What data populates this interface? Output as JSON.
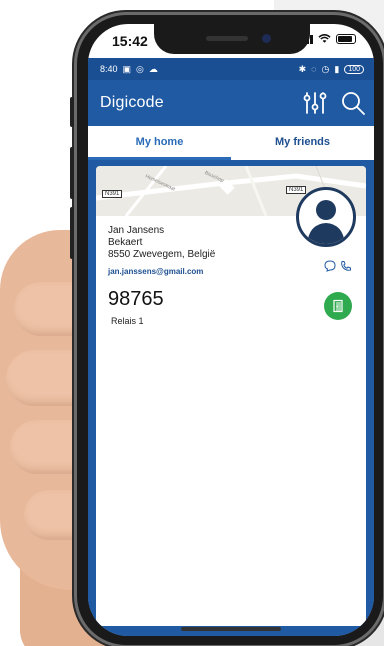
{
  "ios_status": {
    "time": "15:42"
  },
  "android_status": {
    "time": "8:40",
    "battery": "100"
  },
  "appbar": {
    "title": "Digicode"
  },
  "tabs": [
    {
      "label": "My home",
      "active": true
    },
    {
      "label": "My friends",
      "active": false
    }
  ],
  "map": {
    "road_left": "N391",
    "road_right": "N391",
    "street1": "Hemelsestraat",
    "street2": "Bisschop"
  },
  "contact": {
    "name": "Jan Jansens",
    "company": "Bekaert",
    "address": "8550 Zwevegem, België",
    "email": "jan.janssens@gmail.com",
    "code": "98765",
    "relay": "Relais 1"
  },
  "colors": {
    "primary": "#1f5aa3",
    "open_button": "#2faa4f"
  }
}
